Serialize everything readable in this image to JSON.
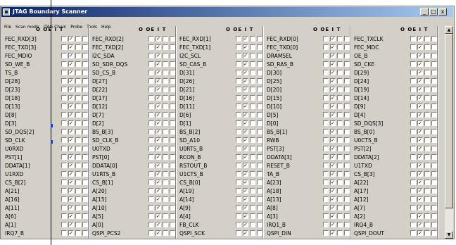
{
  "window": {
    "title": "JTAG Boundary Scanner",
    "controls": {
      "minimize": "_",
      "maximize": "□",
      "close": "x"
    }
  },
  "menu": [
    "File",
    "Scan mode",
    "JTAG Chain",
    "Probe",
    "Tools",
    "Help"
  ],
  "column_header": "O OE I T",
  "checkbox_columns": [
    "O",
    "OE",
    "I",
    "T"
  ],
  "checked_column": "OE",
  "columns": [
    [
      "FEC_RXD[3]",
      "FEC_TXD[3]",
      "FEC_MDIO",
      "SD_WE_B",
      "TS_B",
      "D[28]",
      "D[23]",
      "D[18]",
      "D[13]",
      "D[8]",
      "D[3]",
      "SD_DQS[2]",
      "SD_CLK",
      "U0RXD",
      "PST[1]",
      "DDATA[1]",
      "U1RXD",
      "CS_B[2]",
      "A[21]",
      "A[16]",
      "A[11]",
      "A[6]",
      "A[1]",
      "IRQ7_B"
    ],
    [
      "FEC_RXD[2]",
      "FEC_TXD[2]",
      "I2C_SDA",
      "SD_SDR_DQS",
      "SD_CS_B",
      "D[27]",
      "D[22]",
      "D[17]",
      "D[12]",
      "D[7]",
      "D[2]",
      "BS_B[3]",
      "SD_CLK_B",
      "U0TXD",
      "PST[0]",
      "DDATA[0]",
      "U1RTS_B",
      "CS_B[1]",
      "A[20]",
      "A[15]",
      "A[10]",
      "A[5]",
      "A[0]",
      "QSPI_PCS2"
    ],
    [
      "FEC_RXD[1]",
      "FEC_TXD[1]",
      "I2C_SCL",
      "SD_CAS_B",
      "D[31]",
      "D[26]",
      "D[21]",
      "D[16]",
      "D[11]",
      "D[6]",
      "D[1]",
      "BS_B[2]",
      "SD_A10",
      "U0RTS_B",
      "RCON_B",
      "RSTOUT_B",
      "U1CTS_B",
      "CS_B[0]",
      "A[19]",
      "A[14]",
      "A[9]",
      "A[4]",
      "FB_CLK",
      "QSPI_SCK"
    ],
    [
      "FEC_RXD[0]",
      "FEC_TXD[0]",
      "DRAMSEL",
      "SD_RAS_B",
      "D[30]",
      "D[25]",
      "D[20]",
      "D[15]",
      "D[10]",
      "D[5]",
      "D[0]",
      "BS_B[1]",
      "RWB",
      "PST[3]",
      "DDATA[3]",
      "RESET_B",
      "TA_B",
      "A[23]",
      "A[18]",
      "A[13]",
      "A[8]",
      "A[3]",
      "IRQ1_B",
      "QSPI_DIN"
    ],
    [
      "FEC_TXCLK",
      "FEC_MDC",
      "OE_B",
      "SD_CKE",
      "D[29]",
      "D[24]",
      "D[19]",
      "D[14]",
      "D[9]",
      "D[4]",
      "SD_DQS[3]",
      "BS_B[0]",
      "U0CTS_B",
      "PST[2]",
      "DDATA[2]",
      "U1TXD",
      "CS_B[3]",
      "A[22]",
      "A[17]",
      "A[12]",
      "A[7]",
      "A[2]",
      "IRQ4_B",
      "QSPI_DOUT"
    ]
  ],
  "scrollbar": {
    "up": "▲",
    "down": "▼"
  },
  "colors": {
    "title_start": "#0a246a",
    "title_end": "#a6caf0",
    "face": "#d4d0c8",
    "cursor_marker": "#1a3fd0"
  }
}
